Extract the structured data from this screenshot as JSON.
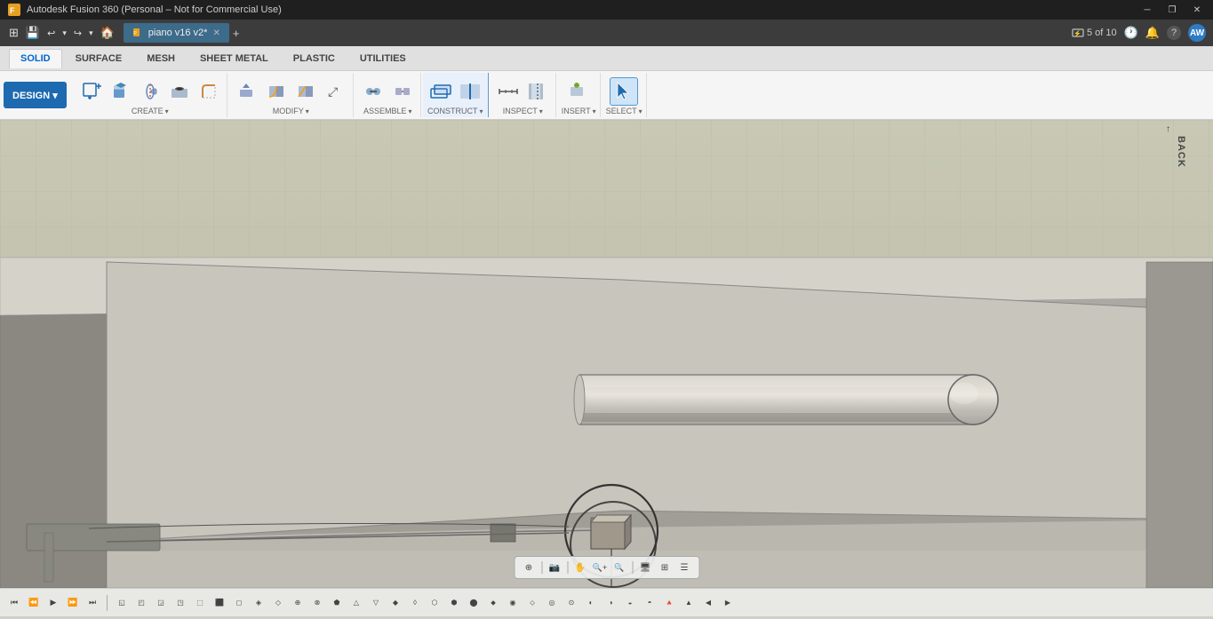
{
  "titlebar": {
    "app_name": "Autodesk Fusion 360 (Personal – Not for Commercial Use)",
    "minimize": "─",
    "restore": "❐",
    "close": "✕"
  },
  "quickaccess": {
    "buttons": [
      "⊞",
      "💾",
      "↩",
      "↪",
      "🏠"
    ]
  },
  "filetab": {
    "filename": "piano v16 v2*",
    "page_info": "5 of 10",
    "close": "✕",
    "add_btn": "+",
    "time_icon": "🕐",
    "bell_icon": "🔔",
    "help_icon": "?",
    "user": "AW"
  },
  "tabs": [
    {
      "label": "SOLID",
      "active": true
    },
    {
      "label": "SURFACE",
      "active": false
    },
    {
      "label": "MESH",
      "active": false
    },
    {
      "label": "SHEET METAL",
      "active": false
    },
    {
      "label": "PLASTIC",
      "active": false
    },
    {
      "label": "UTILITIES",
      "active": false
    }
  ],
  "toolbar": {
    "design_btn": "DESIGN ▾",
    "sections": [
      {
        "label": "CREATE ▾",
        "items": [
          {
            "name": "new-body",
            "icon": "⬚+",
            "title": "New Component"
          },
          {
            "name": "extrude",
            "icon": "▣",
            "title": "Extrude"
          },
          {
            "name": "revolve",
            "icon": "◑",
            "title": "Revolve"
          },
          {
            "name": "hole",
            "icon": "◎",
            "title": "Hole"
          },
          {
            "name": "fillet",
            "icon": "★",
            "title": "Fillet"
          }
        ]
      },
      {
        "label": "MODIFY ▾",
        "items": [
          {
            "name": "press-pull",
            "icon": "⬒",
            "title": "Press Pull"
          },
          {
            "name": "fillet-m",
            "icon": "◱",
            "title": "Fillet"
          },
          {
            "name": "chamfer",
            "icon": "◨",
            "title": "Chamfer"
          },
          {
            "name": "move",
            "icon": "⤢",
            "title": "Move/Copy"
          }
        ]
      },
      {
        "label": "ASSEMBLE ▾",
        "items": [
          {
            "name": "joint",
            "icon": "⚙",
            "title": "Joint"
          },
          {
            "name": "rigid-group",
            "icon": "⬜",
            "title": "Rigid Group"
          }
        ]
      },
      {
        "label": "CONSTRUCT ▾",
        "items": [
          {
            "name": "offset-plane",
            "icon": "▱",
            "title": "Offset Plane"
          },
          {
            "name": "midplane",
            "icon": "▦",
            "title": "Midplane"
          }
        ]
      },
      {
        "label": "INSPECT ▾",
        "items": [
          {
            "name": "measure",
            "icon": "📏",
            "title": "Measure"
          },
          {
            "name": "section-analysis",
            "icon": "🖼",
            "title": "Section Analysis"
          }
        ]
      },
      {
        "label": "INSERT ▾",
        "items": [
          {
            "name": "insert-mesh",
            "icon": "🔲",
            "title": "Insert Mesh"
          }
        ]
      },
      {
        "label": "SELECT ▾",
        "items": [
          {
            "name": "select",
            "icon": "↖",
            "title": "Select"
          }
        ]
      }
    ]
  },
  "viewport": {
    "back_label": "BACK",
    "orientation_arrow": "↑"
  },
  "float_toolbar": {
    "buttons": [
      "⊕",
      "📷",
      "✋",
      "🔍+",
      "🔍",
      "🖥",
      "⊞",
      "☰"
    ],
    "separators_after": [
      0,
      1,
      3,
      4
    ]
  },
  "bottom_bar": {
    "tools": [
      "⏮",
      "⏪",
      "▶",
      "⏩",
      "⏭"
    ],
    "icons_left": [
      "◱",
      "◰",
      "◲",
      "◳",
      "⬚",
      "⬛",
      "◻",
      "⬙",
      "◈",
      "◇",
      "◆",
      "⊕",
      "⊗",
      "⊙",
      "↻",
      "🔺",
      "△",
      "⬟",
      "⬡",
      "⬢",
      "◈",
      "◉",
      "◊",
      "⧫",
      "⬠",
      "⬡",
      "⬢",
      "⬣",
      "⬤",
      "⬥",
      "⬦",
      "⬧",
      "⬨",
      "⬩",
      "⬪",
      "⬫"
    ],
    "label": ""
  }
}
